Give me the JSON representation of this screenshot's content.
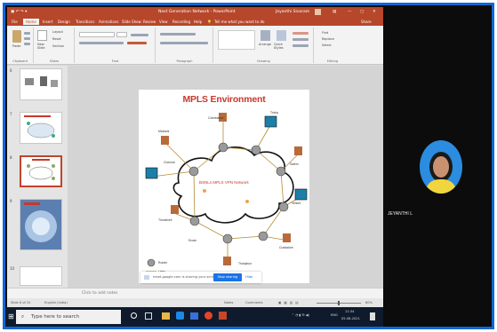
{
  "window": {
    "title": "Next Generation Network - PowerPoint",
    "user": "Jeyanthi Sivaram"
  },
  "ribbon_tabs": [
    "File",
    "Home",
    "Insert",
    "Design",
    "Transitions",
    "Animations",
    "Slide Show",
    "Review",
    "View",
    "Recording",
    "Help"
  ],
  "tell_me": "Tell me what you want to do",
  "share_label": "Share",
  "ribbon_groups": {
    "clipboard": "Clipboard",
    "slides": "Slides",
    "font": "Font",
    "paragraph": "Paragraph",
    "drawing": "Drawing",
    "editing": "Editing",
    "new_slide": "New Slide",
    "layout": "Layout",
    "reset": "Reset",
    "section": "Section",
    "paste": "Paste",
    "arrange": "Arrange",
    "quick_styles": "Quick Styles",
    "find": "Find",
    "replace": "Replace",
    "select": "Select"
  },
  "thumbnails": [
    {
      "num": "6"
    },
    {
      "num": "7"
    },
    {
      "num": "8"
    },
    {
      "num": "9"
    },
    {
      "num": "10"
    }
  ],
  "slide": {
    "title": "MPLS Environment",
    "cloud_label": "BSNLs MPLS VPN Network",
    "cities": {
      "coimbatore": "Coimbatore",
      "trichy": "Trichy",
      "madurai": "Madurai",
      "chennai": "Chennai",
      "salem": "Salem",
      "vellore": "Vellore",
      "tirunelveli": "Tirunelveli",
      "erode": "Erode",
      "cuddalore": "Cuddalore",
      "thanjavur": "Thanjavur"
    },
    "legend": {
      "router": "Router",
      "links": "Links"
    }
  },
  "notes_placeholder": "Click to add notes",
  "screen_share": {
    "message": "meet.google.com is sharing your screen.",
    "stop_button": "Stop sharing",
    "hide_button": "Hide"
  },
  "status_bar": {
    "slide_info": "Slide 8 of 31",
    "language": "English (India)",
    "notes": "Notes",
    "comments": "Comments",
    "zoom": "60%"
  },
  "taskbar": {
    "search_placeholder": "Type here to search",
    "lang": "ENG",
    "time": "11:34",
    "date": "05-08-2021"
  },
  "participant": {
    "name": "JEYANTHI L"
  },
  "colors": {
    "accent": "#b7472a",
    "border": "#1167d6",
    "title_red": "#c8382b"
  }
}
